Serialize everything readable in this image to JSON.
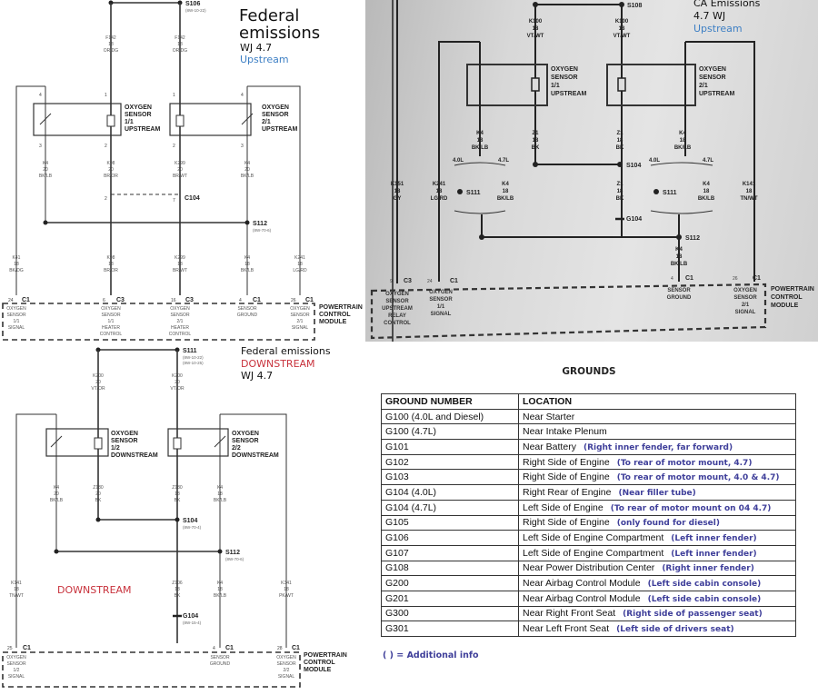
{
  "federal_upstream": {
    "title_line1": "Federal",
    "title_line2": "emissions",
    "model": "WJ 4.7",
    "position": "Upstream",
    "splice_top": "S106",
    "splice_top_ref": "(8W-10-22)",
    "wire_f142": [
      "F142",
      "18",
      "OR/DG"
    ],
    "sensor_11": [
      "OXYGEN",
      "SENSOR",
      "1/1",
      "UPSTREAM"
    ],
    "sensor_21": [
      "OXYGEN",
      "SENSOR",
      "2/1",
      "UPSTREAM"
    ],
    "wire_k4_20": [
      "K4",
      "20",
      "BK/LB"
    ],
    "wire_k98_20": [
      "K98",
      "20",
      "BR/OR"
    ],
    "wire_k299_20": [
      "K299",
      "20",
      "BR/WT"
    ],
    "connector_mid": "C104",
    "splice_mid": "S112",
    "splice_mid_ref": "(8W-70-6)",
    "wire_k41": [
      "K41",
      "18",
      "BK/DG"
    ],
    "wire_k98_18": [
      "K98",
      "18",
      "BR/OR"
    ],
    "wire_k299_18": [
      "K299",
      "18",
      "BR/WT"
    ],
    "wire_k4_18": [
      "K4",
      "18",
      "BK/LB"
    ],
    "wire_k241": [
      "K241",
      "18",
      "LG/RD"
    ],
    "pcm_pins": [
      {
        "pin": "24",
        "conn": "C1",
        "label": [
          "OXYGEN",
          "SENSOR",
          "1/1",
          "SIGNAL"
        ]
      },
      {
        "pin": "6",
        "conn": "C3",
        "label": [
          "OXYGEN",
          "SENSOR",
          "1/1",
          "HEATER",
          "CONTROL"
        ]
      },
      {
        "pin": "16",
        "conn": "C3",
        "label": [
          "OXYGEN",
          "SENSOR",
          "2/1",
          "HEATER",
          "CONTROL"
        ]
      },
      {
        "pin": "4",
        "conn": "C1",
        "label": [
          "SENSOR",
          "GROUND"
        ]
      },
      {
        "pin": "26",
        "conn": "C1",
        "label": [
          "OXYGEN",
          "SENSOR",
          "2/1",
          "SIGNAL"
        ]
      }
    ],
    "pcm_name": [
      "POWERTRAIN",
      "CONTROL",
      "MODULE"
    ]
  },
  "ca_upstream": {
    "title_line1": "CA Emissions",
    "model": "4.7 WJ",
    "position": "Upstream",
    "splice_top": "S108",
    "wire_k100": [
      "K100",
      "18",
      "VT/WT"
    ],
    "sensor_11": [
      "OXYGEN",
      "SENSOR",
      "1/1",
      "UPSTREAM"
    ],
    "sensor_21": [
      "OXYGEN",
      "SENSOR",
      "2/1",
      "UPSTREAM"
    ],
    "wire_k4": [
      "K4",
      "18",
      "BK/LB"
    ],
    "wire_z1": [
      "Z1",
      "18",
      "BK"
    ],
    "splice_s104": "S104",
    "variant_40": "4.0L",
    "variant_47": "4.7L",
    "splice_s111": "S111",
    "ground": "G104",
    "splice_s112": "S112",
    "wire_k151": [
      "K151",
      "18",
      "GY"
    ],
    "wire_k241": [
      "K241",
      "18",
      "LG/RD"
    ],
    "wire_k141": [
      "K141",
      "18",
      "TN/WT"
    ],
    "pcm_pins": [
      {
        "pin": "9",
        "conn": "C3",
        "label": [
          "OXYGEN",
          "SENSOR",
          "UPSTREAM",
          "RELAY",
          "CONTROL"
        ]
      },
      {
        "pin": "24",
        "conn": "C1",
        "label": [
          "OXYGEN",
          "SENSOR",
          "1/1",
          "SIGNAL"
        ]
      },
      {
        "pin": "4",
        "conn": "C1",
        "label": [
          "SENSOR",
          "GROUND"
        ]
      },
      {
        "pin": "26",
        "conn": "C1",
        "label": [
          "OXYGEN",
          "SENSOR",
          "2/1",
          "SIGNAL"
        ]
      }
    ],
    "pcm_name": [
      "POWERTRAIN",
      "CONTROL",
      "MODULE"
    ]
  },
  "federal_downstream": {
    "title_line1": "Federal emissions",
    "position": "DOWNSTREAM",
    "model": "WJ 4.7",
    "watermark": "DOWNSTREAM",
    "splice_top": "S111",
    "splice_top_ref1": "(8W-10-22)",
    "splice_top_ref2": "(8W-10-25)",
    "wire_k200": [
      "K200",
      "20",
      "VT/OR"
    ],
    "sensor_12": [
      "OXYGEN",
      "SENSOR",
      "1/2",
      "DOWNSTREAM"
    ],
    "sensor_22": [
      "OXYGEN",
      "SENSOR",
      "2/2",
      "DOWNSTREAM"
    ],
    "wire_k4_20": [
      "K4",
      "20",
      "BK/LB"
    ],
    "wire_z180": [
      "Z180",
      "20",
      "BK"
    ],
    "wire_z180b": [
      "Z180",
      "18",
      "BK"
    ],
    "wire_k4_18": [
      "K4",
      "18",
      "BK/LB"
    ],
    "splice_s104": "S104",
    "splice_s104_ref": "(8W-70-4)",
    "splice_s112": "S112",
    "splice_s112_ref": "(8W-70-6)",
    "wire_k141": [
      "K141",
      "18",
      "TN/WT"
    ],
    "wire_z106": [
      "Z106",
      "18",
      "BK"
    ],
    "wire_k4b": [
      "K4",
      "18",
      "BK/LB"
    ],
    "wire_k341": [
      "K341",
      "18",
      "PK/WT"
    ],
    "ground": "G104",
    "ground_ref": "(8W-15-4)",
    "pcm_pins": [
      {
        "pin": "25",
        "conn": "C1",
        "label": [
          "OXYGEN",
          "SENSOR",
          "1/2",
          "SIGNAL"
        ]
      },
      {
        "pin": "4",
        "conn": "C1",
        "label": [
          "SENSOR",
          "GROUND"
        ]
      },
      {
        "pin": "28",
        "conn": "C1",
        "label": [
          "OXYGEN",
          "SENSOR",
          "2/2",
          "SIGNAL"
        ]
      }
    ],
    "pcm_name": [
      "POWERTRAIN",
      "CONTROL",
      "MODULE"
    ]
  },
  "grounds": {
    "title": "GROUNDS",
    "columns": [
      "GROUND NUMBER",
      "LOCATION"
    ],
    "rows": [
      {
        "number": "G100 (4.0L and Diesel)",
        "location": "Near Starter",
        "note": ""
      },
      {
        "number": "G100 (4.7L)",
        "location": "Near Intake Plenum",
        "note": ""
      },
      {
        "number": "G101",
        "location": "Near Battery",
        "note": "(Right inner fender, far forward)"
      },
      {
        "number": "G102",
        "location": "Right Side of Engine",
        "note": "(To rear of motor mount, 4.7)"
      },
      {
        "number": "G103",
        "location": "Right Side of Engine",
        "note": "(To rear of motor mount, 4.0 & 4.7)"
      },
      {
        "number": "G104 (4.0L)",
        "location": "Right Rear of Engine",
        "note": "(Near filler tube)"
      },
      {
        "number": "G104 (4.7L)",
        "location": "Left Side of Engine",
        "note": "(To rear of motor mount on 04 4.7)"
      },
      {
        "number": "G105",
        "location": "Right Side of Engine",
        "note": "(only found for diesel)"
      },
      {
        "number": "G106",
        "location": "Left Side of Engine Compartment",
        "note": "(Left inner fender)"
      },
      {
        "number": "G107",
        "location": "Left Side of Engine Compartment",
        "note": "(Left inner fender)"
      },
      {
        "number": "G108",
        "location": "Near Power Distribution Center",
        "note": "(Right inner fender)"
      },
      {
        "number": "G200",
        "location": "Near Airbag Control Module",
        "note": "(Left side cabin console)"
      },
      {
        "number": "G201",
        "location": "Near Airbag Control Module",
        "note": "(Left side cabin console)"
      },
      {
        "number": "G300",
        "location": "Near Right Front Seat",
        "note": "(Right side of passenger seat)"
      },
      {
        "number": "G301",
        "location": "Near Left Front Seat",
        "note": "(Left side of drivers seat)"
      }
    ],
    "footnote": "( ) = Additional info"
  },
  "colors": {
    "upstream_blue": "#3d7fc4",
    "downstream_red": "#c8323c",
    "note_blue": "#3f3f9a"
  }
}
